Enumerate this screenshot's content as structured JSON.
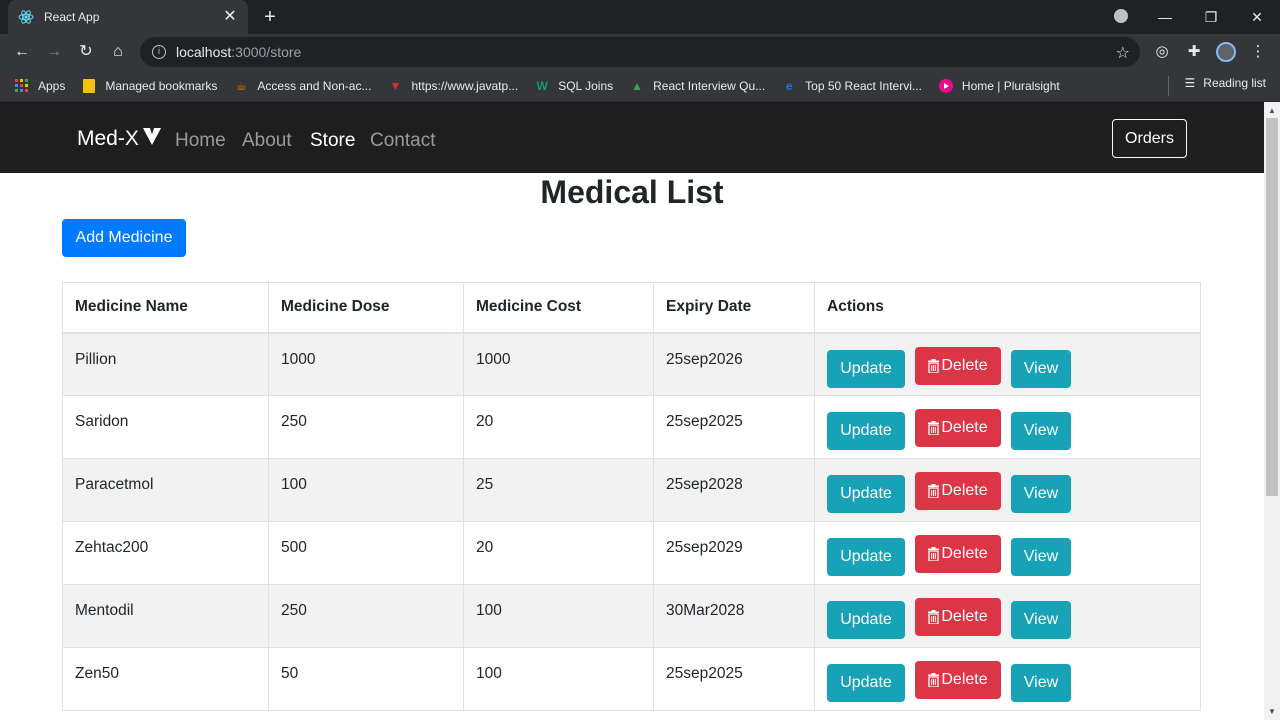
{
  "browser": {
    "tab_title": "React App",
    "url_host": "localhost",
    "url_path": ":3000/store",
    "bookmarks": [
      {
        "label": "Apps",
        "icon": "apps-grid-icon",
        "color": "#ea4335"
      },
      {
        "label": "Managed bookmarks",
        "icon": "folder-icon",
        "color": "#f4c20d"
      },
      {
        "label": "Access and Non-ac...",
        "icon": "bookmark-site-icon",
        "color": "#e37400"
      },
      {
        "label": "https://www.javatp...",
        "icon": "javatpoint-icon",
        "color": "#d93025"
      },
      {
        "label": "SQL Joins",
        "icon": "w3-icon",
        "color": "#0f9d58"
      },
      {
        "label": "React Interview Qu...",
        "icon": "mountain-icon",
        "color": "#34a853"
      },
      {
        "label": "Top 50 React Intervi...",
        "icon": "edureka-icon",
        "color": "#1a73e8"
      },
      {
        "label": "Home | Pluralsight",
        "icon": "pluralsight-icon",
        "color": "#e80a89"
      }
    ],
    "reading_list": "Reading list"
  },
  "app": {
    "brand": "Med-X",
    "nav": {
      "home": "Home",
      "about": "About",
      "store": "Store",
      "contact": "Contact"
    },
    "orders_label": "Orders",
    "heading": "Medical List",
    "add_label": "Add Medicine",
    "columns": [
      "Medicine Name",
      "Medicine Dose",
      "Medicine Cost",
      "Expiry Date",
      "Actions"
    ],
    "rows": [
      {
        "name": "Pillion",
        "dose": "1000",
        "cost": "1000",
        "expiry": "25sep2026"
      },
      {
        "name": "Saridon",
        "dose": "250",
        "cost": "20",
        "expiry": "25sep2025"
      },
      {
        "name": "Paracetmol",
        "dose": "100",
        "cost": "25",
        "expiry": "25sep2028"
      },
      {
        "name": "Zehtac200",
        "dose": "500",
        "cost": "20",
        "expiry": "25sep2029"
      },
      {
        "name": "Mentodil",
        "dose": "250",
        "cost": "100",
        "expiry": "30Mar2028"
      },
      {
        "name": "Zen50",
        "dose": "50",
        "cost": "100",
        "expiry": "25sep2025"
      }
    ],
    "actions": {
      "update": "Update",
      "delete": "Delete",
      "view": "View"
    }
  }
}
